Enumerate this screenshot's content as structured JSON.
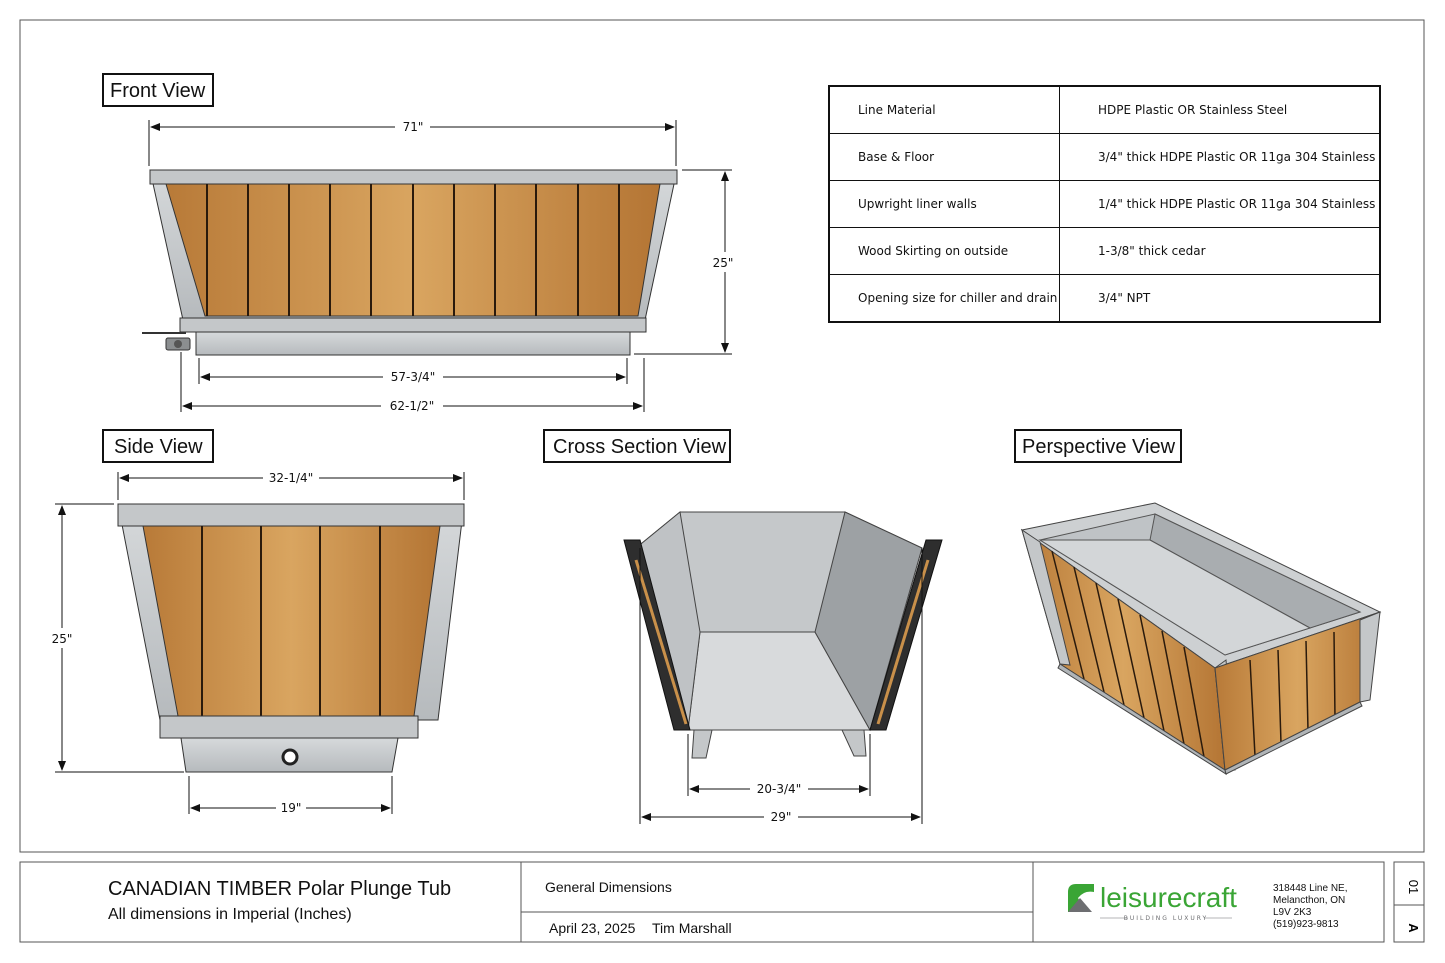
{
  "views": {
    "front": "Front View",
    "side": "Side View",
    "cross": "Cross Section View",
    "perspective": "Perspective View"
  },
  "dimensions": {
    "front_width": "71\"",
    "front_height": "25\"",
    "front_inner": "57-3/4\"",
    "front_outer": "62-1/2\"",
    "side_width": "32-1/4\"",
    "side_height": "25\"",
    "side_base": "19\"",
    "cross_inner": "20-3/4\"",
    "cross_outer": "29\""
  },
  "specs": [
    {
      "label": "Line Material",
      "value": "HDPE Plastic OR Stainless Steel"
    },
    {
      "label": "Base & Floor",
      "value": "3/4\" thick HDPE Plastic OR 11ga 304 Stainless"
    },
    {
      "label": "Upwright liner walls",
      "value": "1/4\" thick HDPE Plastic OR 11ga 304 Stainless"
    },
    {
      "label": "Wood Skirting on outside",
      "value": "1-3/8\" thick cedar"
    },
    {
      "label": "Opening size for chiller and drain",
      "value": "3/4\" NPT"
    }
  ],
  "title_block": {
    "title": "CANADIAN TIMBER Polar Plunge Tub",
    "subtitle": "All dimensions in Imperial (Inches)",
    "sheet_name": "General Dimensions",
    "date": "April 23, 2025",
    "author": "Tim Marshall",
    "logo_text": "leisurecraft",
    "logo_tagline": "BUILDING LUXURY",
    "address": [
      "318448 Line NE,",
      "Melancthon, ON",
      "L9V 2K3",
      "(519)923-9813"
    ],
    "sheet_number": "01",
    "revision": "A"
  },
  "colors": {
    "wood": "#c9904a",
    "steel": "#c9ccce",
    "steel_dark": "#9ea2a5",
    "logo_green": "#3aa535"
  }
}
